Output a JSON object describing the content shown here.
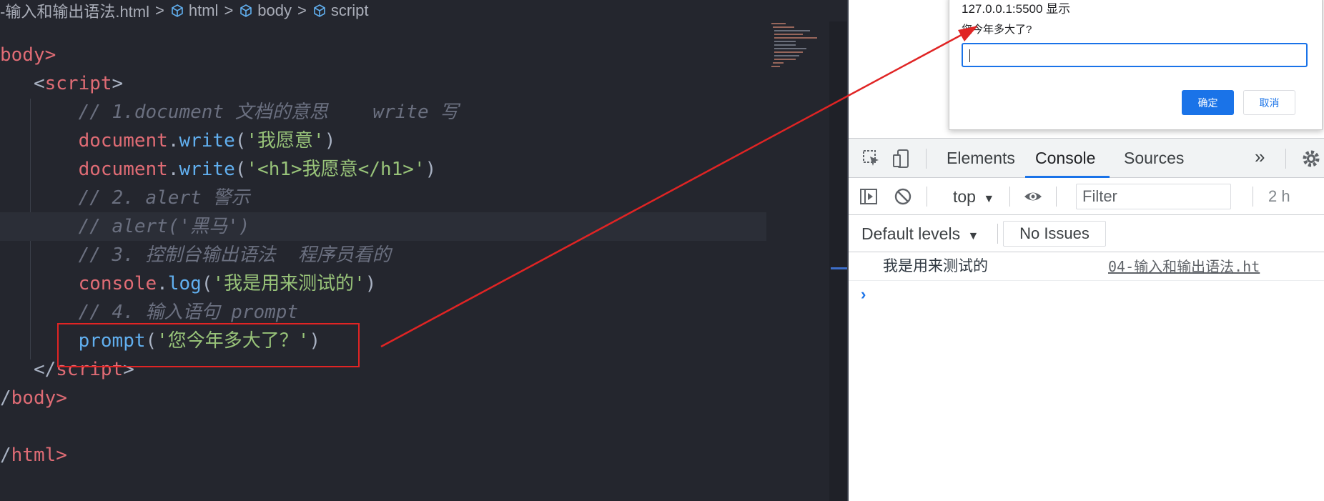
{
  "editor": {
    "breadcrumb": {
      "file": "-输入和输出语法.html",
      "items": [
        "html",
        "body",
        "script"
      ],
      "separator": ">"
    },
    "lines": {
      "body_open": "body>",
      "script_open": "script",
      "c1": "// 1.document 文档的意思    write 写",
      "w1_obj": "document",
      "w1_fn": "write",
      "w1_str": "'我愿意'",
      "w2_obj": "document",
      "w2_fn": "write",
      "w2_str": "'<h1>我愿意</h1>'",
      "c2": "// 2. alert 警示",
      "c3": "// alert('黑马')",
      "c4": "// 3. 控制台输出语法  程序员看的",
      "log_obj": "console",
      "log_fn": "log",
      "log_str": "'我是用来测试的'",
      "c5": "// 4. 输入语句 prompt",
      "prompt_fn": "prompt",
      "prompt_str": "'您今年多大了？'",
      "script_close": "script",
      "body_close": "body>",
      "html_close": "html>"
    }
  },
  "browser": {
    "dialog": {
      "title": "127.0.0.1:5500 显示",
      "message": "您今年多大了?",
      "input_value": "",
      "ok_label": "确定",
      "cancel_label": "取消"
    },
    "devtools": {
      "tabs": [
        "Elements",
        "Console",
        "Sources"
      ],
      "active_tab": "Console",
      "context": "top",
      "filter_placeholder": "Filter",
      "hidden_count": "2 h",
      "levels": "Default levels",
      "issues": "No Issues",
      "messages": [
        {
          "text": "我是用来测试的",
          "source": "04-输入和输出语法.ht"
        }
      ]
    }
  },
  "colors": {
    "editor_bg": "#24262e",
    "annotation_red": "#e02424",
    "accent_blue": "#1a73e8"
  }
}
